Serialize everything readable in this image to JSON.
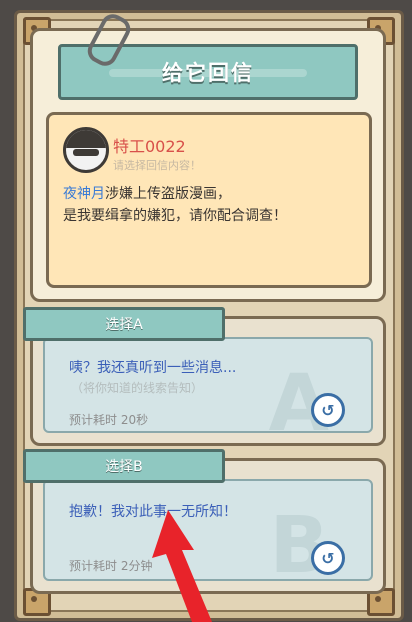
{
  "title": "给它回信",
  "message": {
    "sender": "特工0022",
    "sender_sub": "请选择回信内容！",
    "highlight_name": "夜神月",
    "line1_rest": "涉嫌上传盗版漫画，",
    "line2": "是我要缉拿的嫌犯，请你配合调查！"
  },
  "options": [
    {
      "tag": "选择A",
      "text": "咦？我还真听到一些消息...",
      "hint": "（将你知道的线索告知）",
      "time": "预计耗时  20秒",
      "letter": "A"
    },
    {
      "tag": "选择B",
      "text": "抱歉！我对此事一无所知！",
      "time": "预计耗时  2分钟",
      "letter": "B"
    }
  ],
  "icons": {
    "reply": "reply-icon",
    "clip": "paperclip-icon",
    "avatar": "agent-avatar-icon"
  },
  "colors": {
    "accent_teal": "#8fc8c1",
    "sender_red": "#d8504a",
    "option_blue": "#3b5fb8",
    "arrow_red": "#e8232a"
  }
}
